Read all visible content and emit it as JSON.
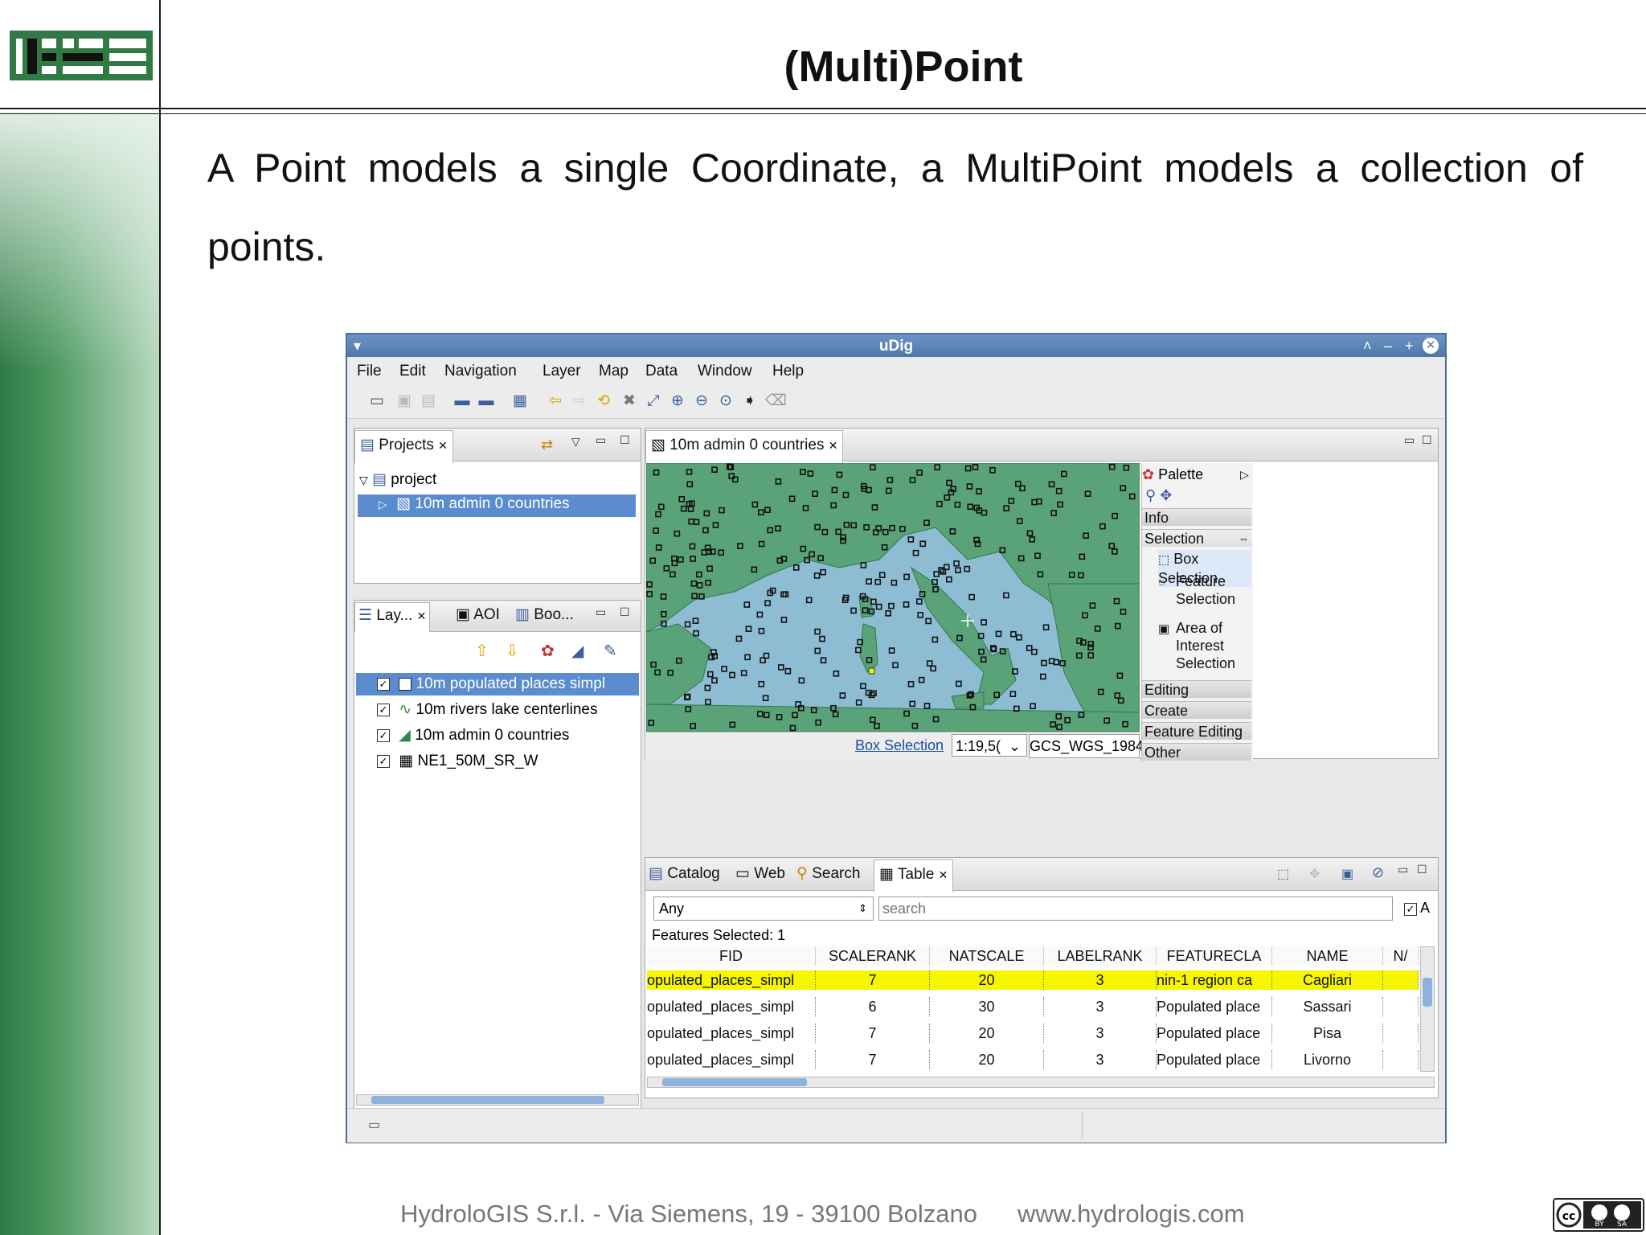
{
  "slide": {
    "title": "(Multi)Point",
    "body": "A Point models a single Coordinate, a MultiPoint models a collection of points.",
    "footer_company": "HydroloGIS S.r.l. - Via Siemens, 19 - 39100 Bolzano",
    "footer_url": "www.hydrologis.com",
    "license_badge": "cc BY SA"
  },
  "app": {
    "window_title": "uDig",
    "menu": [
      "File",
      "Edit",
      "Navigation",
      "Layer",
      "Map",
      "Data",
      "Window",
      "Help"
    ],
    "projects_panel": {
      "tab_label": "Projects",
      "tree": {
        "root": "project",
        "child": "10m admin 0 countries"
      }
    },
    "layers_panel": {
      "tabs": [
        "Lay...",
        "AOI",
        "Boo..."
      ],
      "layers": [
        {
          "name": "10m populated places simpl",
          "checked": true,
          "selected": true
        },
        {
          "name": "10m rivers lake centerlines",
          "checked": true,
          "selected": false
        },
        {
          "name": "10m admin 0 countries",
          "checked": true,
          "selected": false
        },
        {
          "name": "NE1_50M_SR_W",
          "checked": true,
          "selected": false
        }
      ]
    },
    "map_editor": {
      "tab_label": "10m admin 0 countries",
      "status_tool": "Box Selection",
      "scale": "1:19,5(",
      "crs": "GCS_WGS_1984"
    },
    "palette": {
      "title": "Palette",
      "sections": [
        "Info",
        "Selection",
        "Editing",
        "Create",
        "Feature Editing",
        "Other"
      ],
      "selection_items": [
        "Box Selection",
        "Feature Selection",
        "Area of Interest Selection"
      ]
    },
    "bottom_tabs": [
      "Catalog",
      "Web",
      "Search",
      "Table"
    ],
    "table": {
      "filter_value": "Any",
      "search_placeholder": "search",
      "features_selected": "Features Selected: 1",
      "columns": [
        "FID",
        "SCALERANK",
        "NATSCALE",
        "LABELRANK",
        "FEATURECLA",
        "NAME",
        "N/"
      ],
      "rows": [
        [
          "opulated_places_simpl",
          "7",
          "20",
          "3",
          "nin-1 region ca",
          "Cagliari",
          ""
        ],
        [
          "opulated_places_simpl",
          "6",
          "30",
          "3",
          "Populated place",
          "Sassari",
          ""
        ],
        [
          "opulated_places_simpl",
          "7",
          "20",
          "3",
          "Populated place",
          "Pisa",
          ""
        ],
        [
          "opulated_places_simpl",
          "7",
          "20",
          "3",
          "Populated place",
          "Livorno",
          ""
        ]
      ],
      "highlight_color": "#f6f600"
    }
  }
}
